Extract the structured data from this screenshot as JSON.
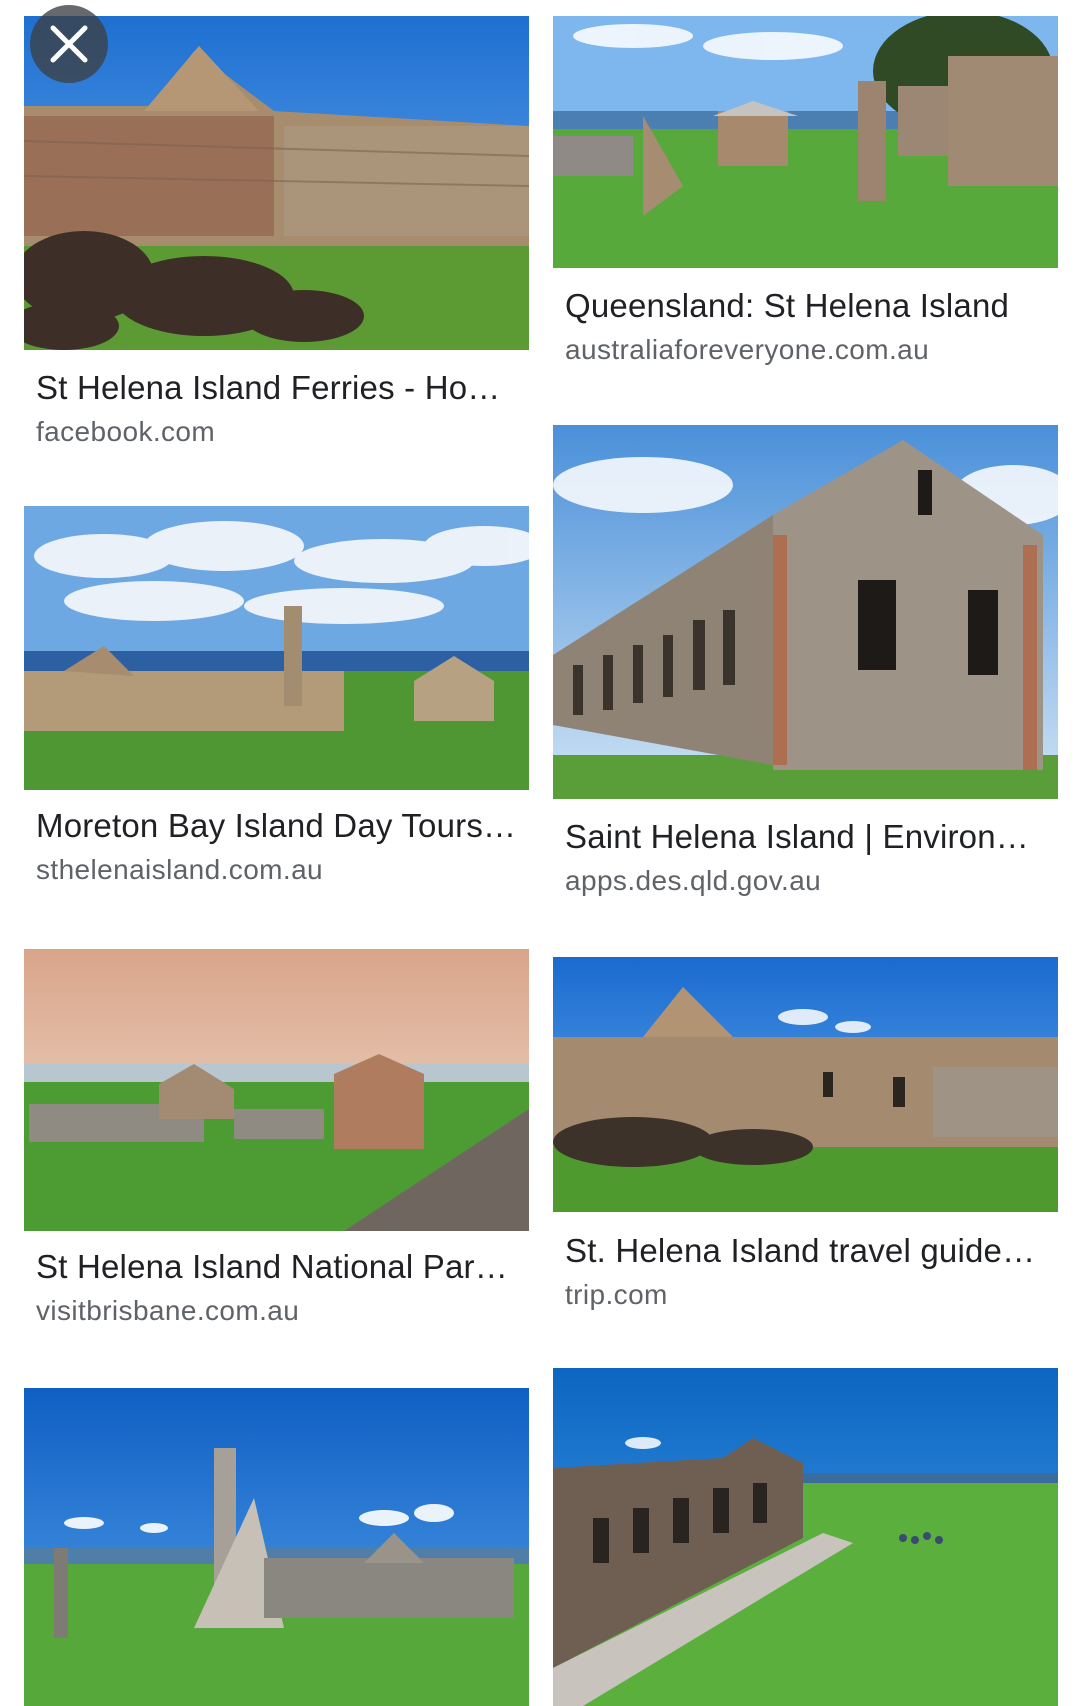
{
  "close_button": {
    "icon": "close-icon",
    "color": "#ffffff"
  },
  "results": [
    {
      "title": "St Helena Island Ferries - Ho…",
      "source": "facebook.com"
    },
    {
      "title": "Queensland: St Helena Island",
      "source": "australiaforeveryone.com.au"
    },
    {
      "title": "Moreton Bay Island Day Tours…",
      "source": "sthelenaisland.com.au"
    },
    {
      "title": "Saint Helena Island | Environ…",
      "source": "apps.des.qld.gov.au"
    },
    {
      "title": "St Helena Island National Par…",
      "source": "visitbrisbane.com.au"
    },
    {
      "title": "St. Helena Island travel guide…",
      "source": "trip.com"
    },
    {
      "title": "",
      "source": ""
    },
    {
      "title": "",
      "source": ""
    }
  ],
  "colors": {
    "title_text": "#202124",
    "source_text": "#5f6368",
    "sky_blue": "#2f7fd6",
    "grass_green": "#4f9b2e",
    "stone": "#9c8a72"
  }
}
